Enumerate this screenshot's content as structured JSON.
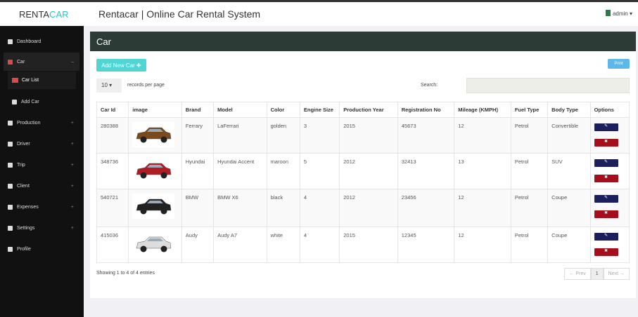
{
  "header": {
    "logo_a": "RENTA",
    "logo_b": "CAR",
    "title": "Rentacar | Online Car Rental System",
    "user": "admin ▾"
  },
  "sidebar": {
    "items": [
      {
        "label": "Dashboard",
        "plus": ""
      },
      {
        "label": "Car",
        "plus": "–"
      },
      {
        "label": "Car List"
      },
      {
        "label": "Add Car"
      },
      {
        "label": "Production",
        "plus": "+"
      },
      {
        "label": "Driver",
        "plus": "+"
      },
      {
        "label": "Trip",
        "plus": "+"
      },
      {
        "label": "Client",
        "plus": "+"
      },
      {
        "label": "Expenses",
        "plus": "+"
      },
      {
        "label": "Settings",
        "plus": "+"
      },
      {
        "label": "Profile",
        "plus": ""
      }
    ]
  },
  "panel": {
    "title": "Car",
    "add_label": "Add New Car ✚",
    "print_label": "Print",
    "page_size": "10 ▾",
    "rpp": "records per page",
    "search_label": "Search:",
    "search_value": ""
  },
  "table": {
    "headers": [
      "Car Id",
      "image",
      "Brand",
      "Model",
      "Color",
      "Engine Size",
      "Production Year",
      "Registration No",
      "Mileage (KMPH)",
      "Fuel Type",
      "Body Type",
      "Options"
    ],
    "rows": [
      {
        "id": "280388",
        "brand": "Ferrary",
        "model": "LaFerrari",
        "color": "golden",
        "engine": "3",
        "year": "2015",
        "reg": "45673",
        "mileage": "12",
        "fuel": "Petrol",
        "body": "Convertible",
        "car_color": "#7a4a1c"
      },
      {
        "id": "348736",
        "brand": "Hyundai",
        "model": "Hyundai Accent",
        "color": "maroon",
        "engine": "5",
        "year": "2012",
        "reg": "32413",
        "mileage": "13",
        "fuel": "Petrol",
        "body": "SUV",
        "car_color": "#b01c24"
      },
      {
        "id": "540721",
        "brand": "BMW",
        "model": "BMW X6",
        "color": "black",
        "engine": "4",
        "year": "2012",
        "reg": "23456",
        "mileage": "12",
        "fuel": "Petrol",
        "body": "Coupe",
        "car_color": "#222"
      },
      {
        "id": "415036",
        "brand": "Audy",
        "model": "Audy A7",
        "color": "white",
        "engine": "4",
        "year": "2015",
        "reg": "12345",
        "mileage": "12",
        "fuel": "Petrol",
        "body": "Coupe",
        "car_color": "#ddd"
      }
    ],
    "edit_icon": "✎",
    "delete_icon": "✖"
  },
  "footer": {
    "info": "Showing 1 to 4 of 4 entries",
    "prev": "← Prev",
    "page": "1",
    "next": "Next →"
  }
}
